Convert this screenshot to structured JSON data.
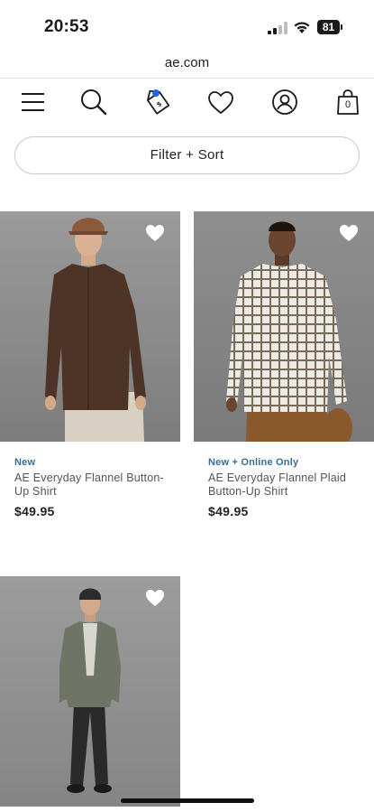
{
  "status_bar": {
    "time": "20:53",
    "battery": "81"
  },
  "browser": {
    "url": "ae.com"
  },
  "nav": {
    "icons": [
      "menu-icon",
      "search-icon",
      "deals-tag-icon",
      "wishlist-heart-icon",
      "account-icon",
      "cart-bag-icon"
    ],
    "cart_count": "0"
  },
  "filter": {
    "label": "Filter + Sort"
  },
  "products": [
    {
      "tag": "New",
      "name": "AE Everyday Flannel Button-Up Shirt",
      "price": "$49.95"
    },
    {
      "tag": "New + Online Only",
      "name": "AE Everyday Flannel Plaid Button-Up Shirt",
      "price": "$49.95"
    },
    {
      "tag": "",
      "name": "",
      "price": ""
    }
  ],
  "colors": {
    "accent": "#3a6d96",
    "badge_dot": "#2563eb",
    "image_bg": "#8a8a8a"
  }
}
